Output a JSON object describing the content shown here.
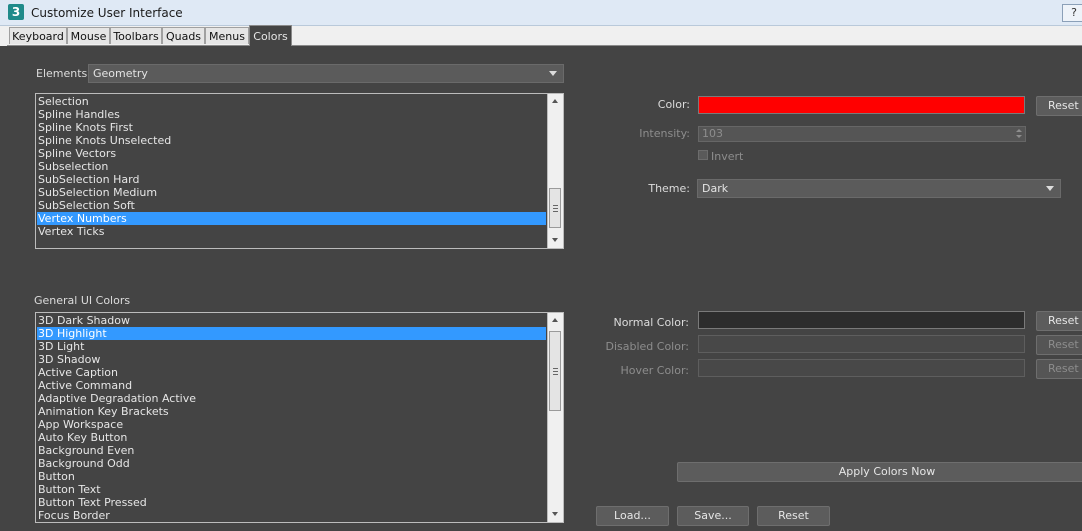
{
  "window": {
    "title": "Customize User Interface",
    "app_icon": "3"
  },
  "tabs": [
    {
      "label": "Keyboard"
    },
    {
      "label": "Mouse"
    },
    {
      "label": "Toolbars"
    },
    {
      "label": "Quads"
    },
    {
      "label": "Menus"
    },
    {
      "label": "Colors",
      "active": true
    }
  ],
  "elements": {
    "label": "Elements:",
    "selected": "Geometry",
    "items": [
      "Selection",
      "Spline Handles",
      "Spline Knots First",
      "Spline Knots Unselected",
      "Spline Vectors",
      "Subselection",
      "SubSelection Hard",
      "SubSelection Medium",
      "SubSelection Soft",
      "Vertex Numbers",
      "Vertex Ticks"
    ],
    "selected_item": "Vertex Numbers"
  },
  "color_panel": {
    "color_label": "Color:",
    "color_value": "#ff0000",
    "reset_label": "Reset",
    "intensity_label": "Intensity:",
    "intensity_value": "103",
    "invert_label": "Invert",
    "theme_label": "Theme:",
    "theme_value": "Dark"
  },
  "general_ui": {
    "title": "General UI Colors",
    "items": [
      "3D Dark Shadow",
      "3D Highlight",
      "3D Light",
      "3D Shadow",
      "Active Caption",
      "Active Command",
      "Adaptive Degradation Active",
      "Animation Key Brackets",
      "App Workspace",
      "Auto Key Button",
      "Background Even",
      "Background Odd",
      "Button",
      "Button Text",
      "Button Text Pressed",
      "Focus Border"
    ],
    "selected_item": "3D Highlight"
  },
  "ui_color_panel": {
    "normal_label": "Normal Color:",
    "normal_value": "#2d2d2d",
    "disabled_label": "Disabled Color:",
    "hover_label": "Hover Color:",
    "reset_label": "Reset"
  },
  "actions": {
    "apply": "Apply Colors Now",
    "load": "Load...",
    "save": "Save...",
    "reset": "Reset"
  },
  "colors": {
    "background": "#444444",
    "selection": "#3399ff",
    "title_bar": "#dfe9f5"
  }
}
